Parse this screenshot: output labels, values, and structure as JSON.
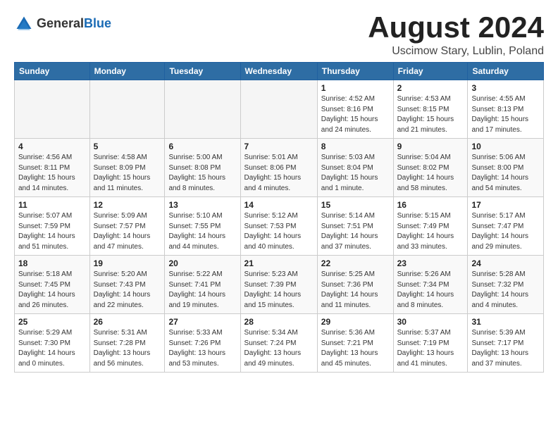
{
  "header": {
    "logo_general": "General",
    "logo_blue": "Blue",
    "month_title": "August 2024",
    "location": "Uscimow Stary, Lublin, Poland"
  },
  "weekdays": [
    "Sunday",
    "Monday",
    "Tuesday",
    "Wednesday",
    "Thursday",
    "Friday",
    "Saturday"
  ],
  "weeks": [
    [
      {
        "day": "",
        "info": ""
      },
      {
        "day": "",
        "info": ""
      },
      {
        "day": "",
        "info": ""
      },
      {
        "day": "",
        "info": ""
      },
      {
        "day": "1",
        "info": "Sunrise: 4:52 AM\nSunset: 8:16 PM\nDaylight: 15 hours\nand 24 minutes."
      },
      {
        "day": "2",
        "info": "Sunrise: 4:53 AM\nSunset: 8:15 PM\nDaylight: 15 hours\nand 21 minutes."
      },
      {
        "day": "3",
        "info": "Sunrise: 4:55 AM\nSunset: 8:13 PM\nDaylight: 15 hours\nand 17 minutes."
      }
    ],
    [
      {
        "day": "4",
        "info": "Sunrise: 4:56 AM\nSunset: 8:11 PM\nDaylight: 15 hours\nand 14 minutes."
      },
      {
        "day": "5",
        "info": "Sunrise: 4:58 AM\nSunset: 8:09 PM\nDaylight: 15 hours\nand 11 minutes."
      },
      {
        "day": "6",
        "info": "Sunrise: 5:00 AM\nSunset: 8:08 PM\nDaylight: 15 hours\nand 8 minutes."
      },
      {
        "day": "7",
        "info": "Sunrise: 5:01 AM\nSunset: 8:06 PM\nDaylight: 15 hours\nand 4 minutes."
      },
      {
        "day": "8",
        "info": "Sunrise: 5:03 AM\nSunset: 8:04 PM\nDaylight: 15 hours\nand 1 minute."
      },
      {
        "day": "9",
        "info": "Sunrise: 5:04 AM\nSunset: 8:02 PM\nDaylight: 14 hours\nand 58 minutes."
      },
      {
        "day": "10",
        "info": "Sunrise: 5:06 AM\nSunset: 8:00 PM\nDaylight: 14 hours\nand 54 minutes."
      }
    ],
    [
      {
        "day": "11",
        "info": "Sunrise: 5:07 AM\nSunset: 7:59 PM\nDaylight: 14 hours\nand 51 minutes."
      },
      {
        "day": "12",
        "info": "Sunrise: 5:09 AM\nSunset: 7:57 PM\nDaylight: 14 hours\nand 47 minutes."
      },
      {
        "day": "13",
        "info": "Sunrise: 5:10 AM\nSunset: 7:55 PM\nDaylight: 14 hours\nand 44 minutes."
      },
      {
        "day": "14",
        "info": "Sunrise: 5:12 AM\nSunset: 7:53 PM\nDaylight: 14 hours\nand 40 minutes."
      },
      {
        "day": "15",
        "info": "Sunrise: 5:14 AM\nSunset: 7:51 PM\nDaylight: 14 hours\nand 37 minutes."
      },
      {
        "day": "16",
        "info": "Sunrise: 5:15 AM\nSunset: 7:49 PM\nDaylight: 14 hours\nand 33 minutes."
      },
      {
        "day": "17",
        "info": "Sunrise: 5:17 AM\nSunset: 7:47 PM\nDaylight: 14 hours\nand 29 minutes."
      }
    ],
    [
      {
        "day": "18",
        "info": "Sunrise: 5:18 AM\nSunset: 7:45 PM\nDaylight: 14 hours\nand 26 minutes."
      },
      {
        "day": "19",
        "info": "Sunrise: 5:20 AM\nSunset: 7:43 PM\nDaylight: 14 hours\nand 22 minutes."
      },
      {
        "day": "20",
        "info": "Sunrise: 5:22 AM\nSunset: 7:41 PM\nDaylight: 14 hours\nand 19 minutes."
      },
      {
        "day": "21",
        "info": "Sunrise: 5:23 AM\nSunset: 7:39 PM\nDaylight: 14 hours\nand 15 minutes."
      },
      {
        "day": "22",
        "info": "Sunrise: 5:25 AM\nSunset: 7:36 PM\nDaylight: 14 hours\nand 11 minutes."
      },
      {
        "day": "23",
        "info": "Sunrise: 5:26 AM\nSunset: 7:34 PM\nDaylight: 14 hours\nand 8 minutes."
      },
      {
        "day": "24",
        "info": "Sunrise: 5:28 AM\nSunset: 7:32 PM\nDaylight: 14 hours\nand 4 minutes."
      }
    ],
    [
      {
        "day": "25",
        "info": "Sunrise: 5:29 AM\nSunset: 7:30 PM\nDaylight: 14 hours\nand 0 minutes."
      },
      {
        "day": "26",
        "info": "Sunrise: 5:31 AM\nSunset: 7:28 PM\nDaylight: 13 hours\nand 56 minutes."
      },
      {
        "day": "27",
        "info": "Sunrise: 5:33 AM\nSunset: 7:26 PM\nDaylight: 13 hours\nand 53 minutes."
      },
      {
        "day": "28",
        "info": "Sunrise: 5:34 AM\nSunset: 7:24 PM\nDaylight: 13 hours\nand 49 minutes."
      },
      {
        "day": "29",
        "info": "Sunrise: 5:36 AM\nSunset: 7:21 PM\nDaylight: 13 hours\nand 45 minutes."
      },
      {
        "day": "30",
        "info": "Sunrise: 5:37 AM\nSunset: 7:19 PM\nDaylight: 13 hours\nand 41 minutes."
      },
      {
        "day": "31",
        "info": "Sunrise: 5:39 AM\nSunset: 7:17 PM\nDaylight: 13 hours\nand 37 minutes."
      }
    ]
  ]
}
